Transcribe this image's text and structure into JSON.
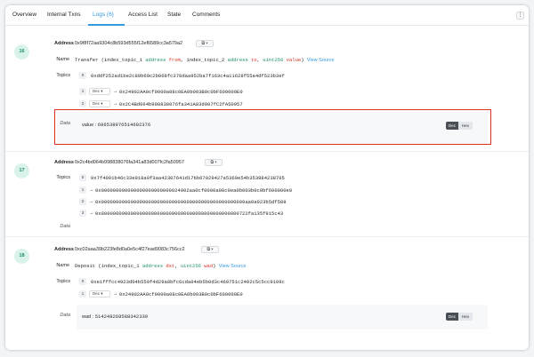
{
  "tabs": [
    {
      "label": "Overview"
    },
    {
      "label": "Internal Txns"
    },
    {
      "label": "Logs (6)"
    },
    {
      "label": "Access List"
    },
    {
      "label": "State"
    },
    {
      "label": "Comments"
    }
  ],
  "more_icon": "⋮",
  "labels": {
    "address": "Address",
    "name": "Name",
    "topics": "Topics",
    "data": "Data",
    "dec": "Dec",
    "hex": "Hex",
    "arrow": "→"
  },
  "logs": [
    {
      "index": "16",
      "address": "0x9f8f72aa9304c8b593d555f12ef6589cc3a579a2",
      "copy_label": "⧉ ▾",
      "name_prefix": "Transfer (index_topic_1 ",
      "name_t1": "address",
      "name_p1": " from",
      "name_c1": ", index_topic_2 ",
      "name_t2": "address",
      "name_p2": " to",
      "name_c2": ", ",
      "name_t3": "uint256",
      "name_p3": " value",
      "name_suffix": ")",
      "view_source": "View Source",
      "topic0": "0xddf252ad1be2c89b69c2b068fc378daa952ba7f163c4a11628f55a4df523b3ef",
      "topic_rows": [
        {
          "idx": "1",
          "fmt": "Dec ▾",
          "value": "0x24902AA0cf0000a08c0EA0b003B0c0bF600000E0"
        },
        {
          "idx": "2",
          "fmt": "Dec ▾",
          "value": "0x2C4Bd064b998838076fa341A83d007fC2fA50957"
        }
      ],
      "data_label": "value",
      "data_value": "6965389765146023​76"
    },
    {
      "index": "17",
      "address": "0x2c4bd064b998838076fa341a83d007fc2fa50957",
      "copy_label": "⧉ ▾",
      "topic0": "0x7f4091b46c33e918a0f3aa42307641d17bb67029427a5369e54b353984238705",
      "topic_rows": [
        {
          "idx": "1",
          "value": "0x000000000000000000000000024902aa0cf0000a08c0ea0b003b0c0bf600000e0"
        },
        {
          "idx": "2",
          "value": "0x0000000000000000000000000000000000000000000000009aa9a023b5df588"
        },
        {
          "idx": "3",
          "value": "0x80000000000000000000000000000000000000000000000722fa135f915c43"
        }
      ]
    },
    {
      "index": "18",
      "address": "0xc02aaa39b223fe8d0a0e5c4f27ead9083c756cc2",
      "copy_label": "⧉ ▾",
      "name_prefix": "Deposit (index_topic_1 ",
      "name_t1": "address",
      "name_p1": " dst",
      "name_c1": ", ",
      "name_t2": "uint256",
      "name_p2": " wad",
      "name_suffix": ")",
      "view_source": "View Source",
      "topic0": "0xe1fffcc4923d04b559f4d29a8bfc6cda04eb5b0d3c460751c2402c5c5cc9109c",
      "topic_rows": [
        {
          "idx": "1",
          "fmt": "Dec ▾",
          "value": "0x24902AA0cf0000a08c0EA0b003B0c0bF600000E0"
        }
      ],
      "data_label": "wad",
      "data_value": "514248268588342339"
    }
  ]
}
